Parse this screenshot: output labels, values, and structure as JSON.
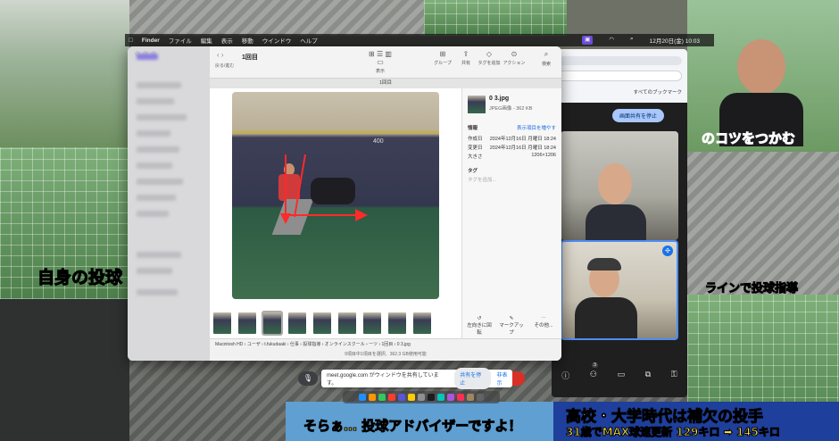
{
  "menubar": {
    "app": "Finder",
    "items": [
      "ファイル",
      "編集",
      "表示",
      "移動",
      "ウインドウ",
      "ヘルプ"
    ],
    "clock": "12月20日(金)  10:03"
  },
  "finder": {
    "title": "1回目",
    "back_label": "戻る/進む",
    "tab_label": "1回目",
    "toolbar": [
      {
        "icon": "view-icon",
        "label": "表示"
      },
      {
        "icon": "group-icon",
        "label": "グループ"
      },
      {
        "icon": "share-icon",
        "label": "共有"
      },
      {
        "icon": "tag-icon",
        "label": "タグを追加"
      },
      {
        "icon": "action-icon",
        "label": "アクション"
      },
      {
        "icon": "search-icon",
        "label": "検索"
      }
    ],
    "info": {
      "filename": "0 3.jpg",
      "kind": "JPEG画像 - 362 KB",
      "section_info": "情報",
      "more_label": "表示項目を増やす",
      "rows": [
        {
          "k": "作成日",
          "v": "2024年12月16日 月曜日 18:24"
        },
        {
          "k": "変更日",
          "v": "2024年12月16日 月曜日 18:24"
        },
        {
          "k": "大きさ",
          "v": "1206×1206"
        }
      ],
      "tags_title": "タグ",
      "tags_placeholder": "タグを追加...",
      "actions": [
        "左向きに回転",
        "マークアップ",
        "その他..."
      ]
    },
    "path": [
      "Macintosh HD",
      "ユーザ",
      "t.fukudaaki",
      "仕事",
      "投球指導",
      "オンラインスクール",
      "ーツ",
      "1回目",
      "0 3.jpg"
    ],
    "status": "9項目中1項目を選択、362.3 GB使用可能",
    "photo_sign": "400"
  },
  "meet": {
    "bookmarks": "すべてのブックマーク",
    "stop_share": "画面共有を停止",
    "participants_count": "3"
  },
  "sharebar": {
    "message": "meet.google.com がウィンドウを共有しています。",
    "stop": "共有を停止",
    "hide": "非表示"
  },
  "captions": {
    "left": "自身の投球",
    "right_top": "のコツをつかむ",
    "right_mid": "ラインで投球指導",
    "bottom_center": "そらぁ… 投球アドバイザーですよ！",
    "bottom_right_1": "高校・大学時代は補欠の投手",
    "bottom_right_2": "31歳でMAX球速更新 129キロ ➡ 145キロ"
  }
}
